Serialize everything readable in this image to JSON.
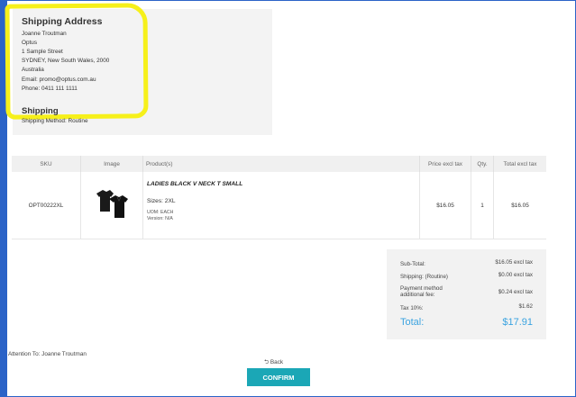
{
  "shipping_address": {
    "title": "Shipping Address",
    "name": "Joanne Troutman",
    "company": "Optus",
    "street": "1 Sample Street",
    "city_line": "SYDNEY, New South Wales, 2000",
    "country": "Australia",
    "email": "Email: promo@optus.com.au",
    "phone": "Phone: 0411 111 1111"
  },
  "shipping": {
    "title": "Shipping",
    "method": "Shipping Method: Routine"
  },
  "table": {
    "headers": [
      "SKU",
      "Image",
      "Product(s)",
      "Price excl tax",
      "Qty.",
      "Total excl tax"
    ],
    "rows": [
      {
        "sku": "OPT00222XL",
        "product_name": "LADIES BLACK V NECK T SMALL",
        "size": "Sizes: 2XL",
        "uom": "UOM: EACH",
        "version": "Version: N/A",
        "price": "$16.05",
        "qty": "1",
        "total": "$16.05"
      }
    ]
  },
  "totals": {
    "subtotal_label": "Sub-Total:",
    "subtotal_value": "$16.05 excl tax",
    "shipping_label": "Shipping: (Routine)",
    "shipping_value": "$0.00 excl tax",
    "payment_label_1": "Payment method",
    "payment_label_2": "additional fee:",
    "payment_value": "$0.24 excl tax",
    "tax_label": "Tax 10%:",
    "tax_value": "$1.62",
    "total_label": "Total:",
    "total_value": "$17.91"
  },
  "footer": {
    "attention": "Attention To: Joanne Troutman",
    "back": "⮌ Back",
    "confirm": "CONFIRM"
  },
  "colors": {
    "frame": "#2b63c7",
    "highlight": "#f6f01a",
    "accent": "#1ba7b6",
    "total": "#3aa3e0"
  }
}
